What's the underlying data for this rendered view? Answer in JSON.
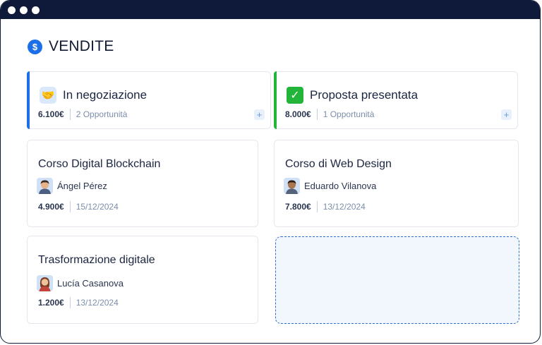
{
  "header": {
    "icon": "dollar-icon",
    "icon_glyph": "$",
    "title": "VENDITE"
  },
  "columns": [
    {
      "title": "In negoziazione",
      "icon": "handshake-icon",
      "icon_glyph": "🤝",
      "accent": "#1c6fe8",
      "amount": "6.100€",
      "opportunities": "2 Opportunità",
      "add_label": "+",
      "cards": [
        {
          "title": "Corso Digital Blockchain",
          "person": "Ángel Pérez",
          "amount": "4.900€",
          "date": "15/12/2024"
        },
        {
          "title": "Trasformazione digitale",
          "person": "Lucía Casanova",
          "amount": "1.200€",
          "date": "13/12/2024"
        }
      ]
    },
    {
      "title": "Proposta presentata",
      "icon": "check-mark-icon",
      "icon_glyph": "✓",
      "accent": "#22b53a",
      "amount": "8.000€",
      "opportunities": "1 Opportunità",
      "add_label": "+",
      "cards": [
        {
          "title": "Corso di Web Design",
          "person": "Eduardo Vilanova",
          "amount": "7.800€",
          "date": "13/12/2024"
        }
      ]
    }
  ]
}
